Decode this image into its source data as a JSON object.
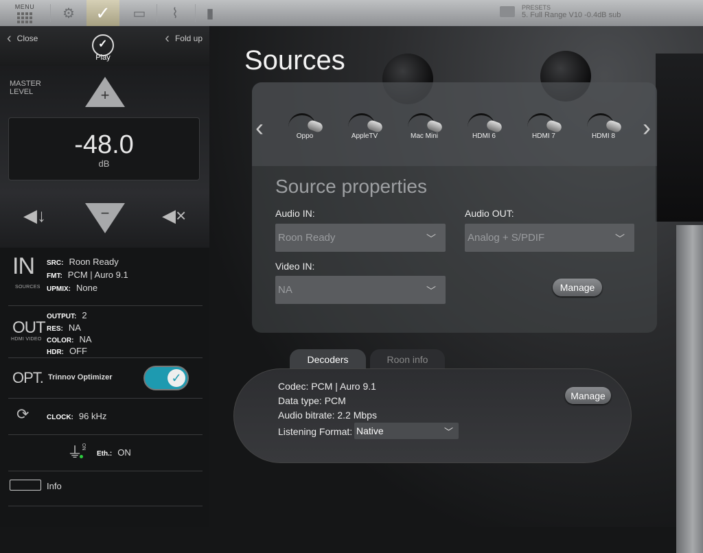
{
  "topbar": {
    "menu_label": "MENU",
    "presets_label": "PRESETS",
    "preset_name": "5. Full Range V10 -0.4dB sub"
  },
  "sidebar": {
    "close_label": "Close",
    "fold_label": "Fold up",
    "logo_text": "Play",
    "master_label": "MASTER LEVEL",
    "level_value": "-48.0",
    "level_unit": "dB",
    "in": {
      "big": "IN",
      "sub": "SOURCES",
      "src_key": "SRC:",
      "src_val": "Roon Ready",
      "fmt_key": "FMT:",
      "fmt_val": "PCM | Auro 9.1",
      "upmix_key": "UPMIX:",
      "upmix_val": "None"
    },
    "out": {
      "big": "OUT",
      "sub": "HDMI VIDEO",
      "output_key": "OUTPUT:",
      "output_val": "2",
      "res_key": "RES:",
      "res_val": "NA",
      "color_key": "COLOR:",
      "color_val": "NA",
      "hdr_key": "HDR:",
      "hdr_val": "OFF"
    },
    "opt": {
      "big": "OPT.",
      "label": "Trinnov Optimizer",
      "toggle_on": true
    },
    "clock": {
      "key": "CLOCK:",
      "val": "96 kHz"
    },
    "eth": {
      "key": "Eth.:",
      "val": "ON",
      "plug_label": "ON"
    },
    "info_label": "Info"
  },
  "main": {
    "title": "Sources",
    "sources": [
      "Oppo",
      "AppleTV",
      "Mac Mini",
      "HDMI 6",
      "HDMI 7",
      "HDMI 8"
    ],
    "props_title": "Source properties",
    "audio_in_label": "Audio IN:",
    "audio_in_value": "Roon Ready",
    "audio_out_label": "Audio OUT:",
    "audio_out_value": "Analog + S/PDIF",
    "video_in_label": "Video IN:",
    "video_in_value": "NA",
    "manage_label": "Manage",
    "tabs": {
      "decoders": "Decoders",
      "roon": "Roon info"
    },
    "decoders": {
      "codec": "Codec: PCM | Auro 9.1",
      "data_type": "Data type: PCM",
      "bitrate": "Audio bitrate: 2.2 Mbps",
      "lf_label": "Listening Format:",
      "lf_value": "Native",
      "manage_label": "Manage"
    }
  },
  "colors": {
    "accent": "#1e9ab0",
    "toggle_on": "#1e9ab0"
  }
}
